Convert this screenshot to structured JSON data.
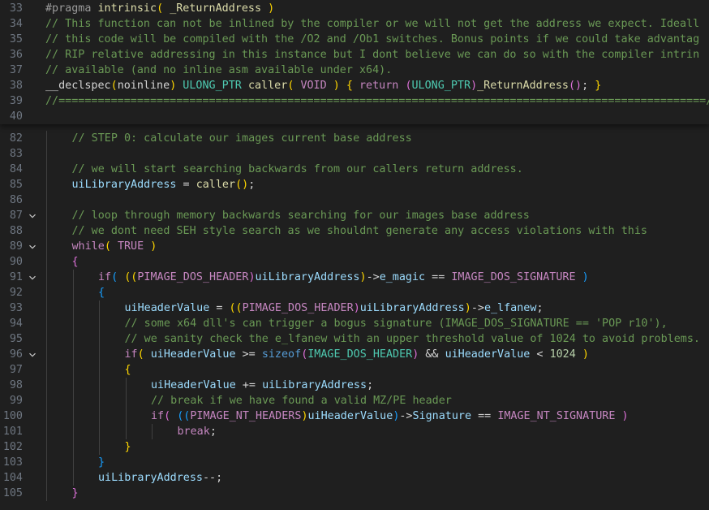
{
  "editor": {
    "language": "C",
    "lines": [
      {
        "n": "33",
        "fold": false,
        "indent": 0,
        "tokens": [
          [
            "#pragma ",
            "k-pre2"
          ],
          [
            "intrinsic",
            "k-fn"
          ],
          [
            "( ",
            "k-b1"
          ],
          [
            "_ReturnAddress",
            "k-fn"
          ],
          [
            " )",
            "k-b1"
          ]
        ]
      },
      {
        "n": "34",
        "fold": false,
        "indent": 0,
        "tokens": [
          [
            "// This function can not be inlined by the compiler or we will not get the address we expect. Ideall",
            "k-cmt"
          ]
        ]
      },
      {
        "n": "35",
        "fold": false,
        "indent": 0,
        "tokens": [
          [
            "// this code will be compiled with the /O2 and /Ob1 switches. Bonus points if we could take advantag",
            "k-cmt"
          ]
        ]
      },
      {
        "n": "36",
        "fold": false,
        "indent": 0,
        "tokens": [
          [
            "// RIP relative addressing in this instance but I dont believe we can do so with the compiler intrin",
            "k-cmt"
          ]
        ]
      },
      {
        "n": "37",
        "fold": false,
        "indent": 0,
        "tokens": [
          [
            "// available (and no inline asm available under x64).",
            "k-cmt"
          ]
        ]
      },
      {
        "n": "38",
        "fold": false,
        "indent": 0,
        "tokens": [
          [
            "__declspec",
            "k-txt"
          ],
          [
            "(",
            "k-b1"
          ],
          [
            "noinline",
            "k-txt"
          ],
          [
            ")",
            "k-b1"
          ],
          [
            " ULONG_PTR ",
            "k-type"
          ],
          [
            "caller",
            "k-fn"
          ],
          [
            "( ",
            "k-b1"
          ],
          [
            "VOID",
            "k-mac"
          ],
          [
            " ) ",
            "k-b1"
          ],
          [
            "{ ",
            "k-b1"
          ],
          [
            "return ",
            "k-ctl"
          ],
          [
            "(",
            "k-b2"
          ],
          [
            "ULONG_PTR",
            "k-type"
          ],
          [
            ")",
            "k-b2"
          ],
          [
            "_ReturnAddress",
            "k-fn"
          ],
          [
            "()",
            "k-b2"
          ],
          [
            "; ",
            "k-txt"
          ],
          [
            "}",
            "k-b1"
          ]
        ]
      },
      {
        "n": "39",
        "fold": false,
        "indent": 0,
        "tokens": [
          [
            "//===================================================================================================//",
            "k-cmt"
          ]
        ]
      },
      {
        "n": "40",
        "fold": false,
        "indent": 0,
        "tokens": []
      },
      {
        "n": "82",
        "fold": false,
        "indent": 1,
        "tokens": [
          [
            "// STEP 0: calculate our images current base address",
            "k-cmt"
          ]
        ]
      },
      {
        "n": "83",
        "fold": false,
        "indent": 1,
        "tokens": []
      },
      {
        "n": "84",
        "fold": false,
        "indent": 1,
        "tokens": [
          [
            "// we will start searching backwards from our callers return address.",
            "k-cmt"
          ]
        ]
      },
      {
        "n": "85",
        "fold": false,
        "indent": 1,
        "tokens": [
          [
            "uiLibraryAddress",
            "k-var"
          ],
          [
            " = ",
            "k-txt"
          ],
          [
            "caller",
            "k-fn"
          ],
          [
            "()",
            "k-b1"
          ],
          [
            ";",
            "k-txt"
          ]
        ]
      },
      {
        "n": "86",
        "fold": false,
        "indent": 1,
        "tokens": []
      },
      {
        "n": "87",
        "fold": true,
        "indent": 1,
        "tokens": [
          [
            "// loop through memory backwards searching for our images base address",
            "k-cmt"
          ]
        ]
      },
      {
        "n": "88",
        "fold": false,
        "indent": 1,
        "tokens": [
          [
            "// we dont need SEH style search as we shouldnt generate any access violations with this",
            "k-cmt"
          ]
        ]
      },
      {
        "n": "89",
        "fold": true,
        "indent": 1,
        "tokens": [
          [
            "while",
            "k-ctl"
          ],
          [
            "( ",
            "k-b1"
          ],
          [
            "TRUE",
            "k-mac"
          ],
          [
            " )",
            "k-b1"
          ]
        ]
      },
      {
        "n": "90",
        "fold": false,
        "indent": 1,
        "tokens": [
          [
            "{",
            "k-b2"
          ]
        ]
      },
      {
        "n": "91",
        "fold": true,
        "indent": 2,
        "tokens": [
          [
            "if",
            "k-ctl"
          ],
          [
            "( ",
            "k-b3"
          ],
          [
            "((",
            "k-b1"
          ],
          [
            "PIMAGE_DOS_HEADER",
            "k-mac"
          ],
          [
            ")",
            "k-b2"
          ],
          [
            "uiLibraryAddress",
            "k-var"
          ],
          [
            ")",
            "k-b1"
          ],
          [
            "->",
            "k-txt"
          ],
          [
            "e_magic",
            "k-var"
          ],
          [
            " == ",
            "k-txt"
          ],
          [
            "IMAGE_DOS_SIGNATURE",
            "k-mac"
          ],
          [
            " )",
            "k-b3"
          ]
        ]
      },
      {
        "n": "92",
        "fold": false,
        "indent": 2,
        "tokens": [
          [
            "{",
            "k-b3"
          ]
        ]
      },
      {
        "n": "93",
        "fold": false,
        "indent": 3,
        "tokens": [
          [
            "uiHeaderValue",
            "k-var"
          ],
          [
            " = ",
            "k-txt"
          ],
          [
            "((",
            "k-b1"
          ],
          [
            "PIMAGE_DOS_HEADER",
            "k-mac"
          ],
          [
            ")",
            "k-b2"
          ],
          [
            "uiLibraryAddress",
            "k-var"
          ],
          [
            ")",
            "k-b1"
          ],
          [
            "->",
            "k-txt"
          ],
          [
            "e_lfanew",
            "k-var"
          ],
          [
            ";",
            "k-txt"
          ]
        ]
      },
      {
        "n": "94",
        "fold": false,
        "indent": 3,
        "tokens": [
          [
            "// some x64 dll's can trigger a bogus signature (IMAGE_DOS_SIGNATURE == 'POP r10'),",
            "k-cmt"
          ]
        ]
      },
      {
        "n": "95",
        "fold": false,
        "indent": 3,
        "tokens": [
          [
            "// we sanity check the e_lfanew with an upper threshold value of 1024 to avoid problems.",
            "k-cmt"
          ]
        ]
      },
      {
        "n": "96",
        "fold": true,
        "indent": 3,
        "tokens": [
          [
            "if",
            "k-ctl"
          ],
          [
            "( ",
            "k-b1"
          ],
          [
            "uiHeaderValue",
            "k-var"
          ],
          [
            " >= ",
            "k-txt"
          ],
          [
            "sizeof",
            "k-kw"
          ],
          [
            "(",
            "k-b2"
          ],
          [
            "IMAGE_DOS_HEADER",
            "k-type"
          ],
          [
            ")",
            "k-b2"
          ],
          [
            " && ",
            "k-txt"
          ],
          [
            "uiHeaderValue",
            "k-var"
          ],
          [
            " < ",
            "k-txt"
          ],
          [
            "1024",
            "k-num"
          ],
          [
            " )",
            "k-b1"
          ]
        ]
      },
      {
        "n": "97",
        "fold": false,
        "indent": 3,
        "tokens": [
          [
            "{",
            "k-b1"
          ]
        ]
      },
      {
        "n": "98",
        "fold": false,
        "indent": 4,
        "tokens": [
          [
            "uiHeaderValue",
            "k-var"
          ],
          [
            " += ",
            "k-txt"
          ],
          [
            "uiLibraryAddress",
            "k-var"
          ],
          [
            ";",
            "k-txt"
          ]
        ]
      },
      {
        "n": "99",
        "fold": false,
        "indent": 4,
        "tokens": [
          [
            "// break if we have found a valid MZ/PE header",
            "k-cmt"
          ]
        ]
      },
      {
        "n": "100",
        "fold": false,
        "indent": 4,
        "tokens": [
          [
            "if",
            "k-ctl"
          ],
          [
            "( ",
            "k-b2"
          ],
          [
            "((",
            "k-b3"
          ],
          [
            "PIMAGE_NT_HEADERS",
            "k-mac"
          ],
          [
            ")",
            "k-b1"
          ],
          [
            "uiHeaderValue",
            "k-var"
          ],
          [
            ")",
            "k-b3"
          ],
          [
            "->",
            "k-txt"
          ],
          [
            "Signature",
            "k-var"
          ],
          [
            " == ",
            "k-txt"
          ],
          [
            "IMAGE_NT_SIGNATURE",
            "k-mac"
          ],
          [
            " )",
            "k-b2"
          ]
        ]
      },
      {
        "n": "101",
        "fold": false,
        "indent": 5,
        "tokens": [
          [
            "break",
            "k-ctl"
          ],
          [
            ";",
            "k-txt"
          ]
        ]
      },
      {
        "n": "102",
        "fold": false,
        "indent": 3,
        "tokens": [
          [
            "}",
            "k-b1"
          ]
        ]
      },
      {
        "n": "103",
        "fold": false,
        "indent": 2,
        "tokens": [
          [
            "}",
            "k-b3"
          ]
        ]
      },
      {
        "n": "104",
        "fold": false,
        "indent": 2,
        "tokens": [
          [
            "uiLibraryAddress",
            "k-var"
          ],
          [
            "--;",
            "k-txt"
          ]
        ]
      },
      {
        "n": "105",
        "fold": false,
        "indent": 1,
        "tokens": [
          [
            "}",
            "k-b2"
          ]
        ]
      }
    ]
  },
  "icons": {
    "fold": "chevron-down-icon"
  }
}
